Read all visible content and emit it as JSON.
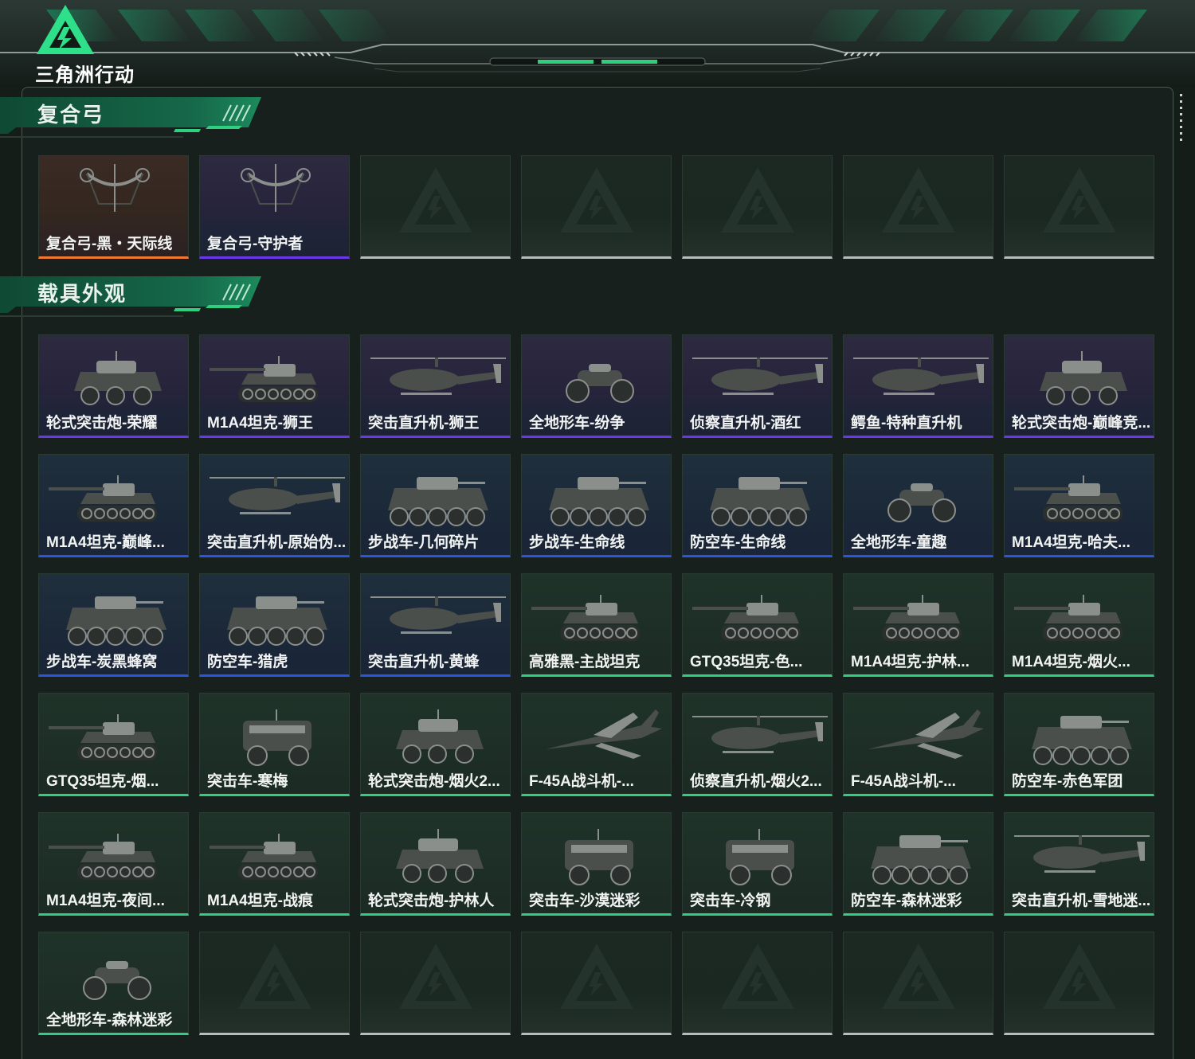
{
  "app": {
    "logo_text": "三角洲行动"
  },
  "sections": [
    {
      "title": "复合弓",
      "items": [
        {
          "name": "复合弓-黑・天际线",
          "quality": "orange",
          "icon": "compound-bow"
        },
        {
          "name": "复合弓-守护者",
          "quality": "purple",
          "icon": "compound-bow"
        },
        {
          "empty": true
        },
        {
          "empty": true
        },
        {
          "empty": true
        },
        {
          "empty": true
        },
        {
          "empty": true
        }
      ]
    },
    {
      "title": "载具外观",
      "items": [
        {
          "name": "轮式突击炮-荣耀",
          "quality": "purple",
          "icon": "wheeled-vehicle"
        },
        {
          "name": "M1A4坦克-狮王",
          "quality": "purple",
          "icon": "tank"
        },
        {
          "name": "突击直升机-狮王",
          "quality": "purple",
          "icon": "helicopter"
        },
        {
          "name": "全地形车-纷争",
          "quality": "purple",
          "icon": "atv"
        },
        {
          "name": "侦察直升机-酒红",
          "quality": "purple",
          "icon": "helicopter"
        },
        {
          "name": "鳄鱼-特种直升机",
          "quality": "purple",
          "icon": "helicopter"
        },
        {
          "name": "轮式突击炮-巅峰竞...",
          "quality": "purple",
          "icon": "wheeled-vehicle"
        },
        {
          "name": "M1A4坦克-巅峰...",
          "quality": "blue",
          "icon": "tank"
        },
        {
          "name": "突击直升机-原始伪...",
          "quality": "blue",
          "icon": "helicopter"
        },
        {
          "name": "步战车-几何碎片",
          "quality": "blue",
          "icon": "apc"
        },
        {
          "name": "步战车-生命线",
          "quality": "blue",
          "icon": "apc"
        },
        {
          "name": "防空车-生命线",
          "quality": "blue",
          "icon": "apc"
        },
        {
          "name": "全地形车-童趣",
          "quality": "blue",
          "icon": "atv"
        },
        {
          "name": "M1A4坦克-哈夫...",
          "quality": "blue",
          "icon": "tank"
        },
        {
          "name": "步战车-炭黑蜂窝",
          "quality": "blue",
          "icon": "apc"
        },
        {
          "name": "防空车-猎虎",
          "quality": "blue",
          "icon": "apc"
        },
        {
          "name": "突击直升机-黄蜂",
          "quality": "blue",
          "icon": "helicopter"
        },
        {
          "name": "高雅黑-主战坦克",
          "quality": "green",
          "icon": "tank"
        },
        {
          "name": "GTQ35坦克-色...",
          "quality": "green",
          "icon": "tank"
        },
        {
          "name": "M1A4坦克-护林...",
          "quality": "green",
          "icon": "tank"
        },
        {
          "name": "M1A4坦克-烟火...",
          "quality": "green",
          "icon": "tank"
        },
        {
          "name": "GTQ35坦克-烟...",
          "quality": "green",
          "icon": "tank"
        },
        {
          "name": "突击车-寒梅",
          "quality": "green",
          "icon": "armored-car"
        },
        {
          "name": "轮式突击炮-烟火2...",
          "quality": "green",
          "icon": "wheeled-vehicle"
        },
        {
          "name": "F-45A战斗机-...",
          "quality": "green",
          "icon": "jet"
        },
        {
          "name": "侦察直升机-烟火2...",
          "quality": "green",
          "icon": "helicopter"
        },
        {
          "name": "F-45A战斗机-...",
          "quality": "green",
          "icon": "jet"
        },
        {
          "name": "防空车-赤色军团",
          "quality": "green",
          "icon": "apc"
        },
        {
          "name": "M1A4坦克-夜间...",
          "quality": "green",
          "icon": "tank"
        },
        {
          "name": "M1A4坦克-战痕",
          "quality": "green",
          "icon": "tank"
        },
        {
          "name": "轮式突击炮-护林人",
          "quality": "green",
          "icon": "wheeled-vehicle"
        },
        {
          "name": "突击车-沙漠迷彩",
          "quality": "green",
          "icon": "armored-car"
        },
        {
          "name": "突击车-冷钢",
          "quality": "green",
          "icon": "armored-car"
        },
        {
          "name": "防空车-森林迷彩",
          "quality": "green",
          "icon": "apc"
        },
        {
          "name": "突击直升机-雪地迷...",
          "quality": "green",
          "icon": "helicopter"
        },
        {
          "name": "全地形车-森林迷彩",
          "quality": "green",
          "icon": "atv"
        },
        {
          "empty": true
        },
        {
          "empty": true
        },
        {
          "empty": true
        },
        {
          "empty": true
        },
        {
          "empty": true
        },
        {
          "empty": true
        }
      ]
    }
  ],
  "colors": {
    "accent": "#2fcf7f",
    "quality_purple": "#6b38e8",
    "quality_blue": "#2a55e0",
    "quality_green": "#2fcf7f",
    "quality_orange": "#f07830",
    "empty_slot": "#b8bcba"
  }
}
